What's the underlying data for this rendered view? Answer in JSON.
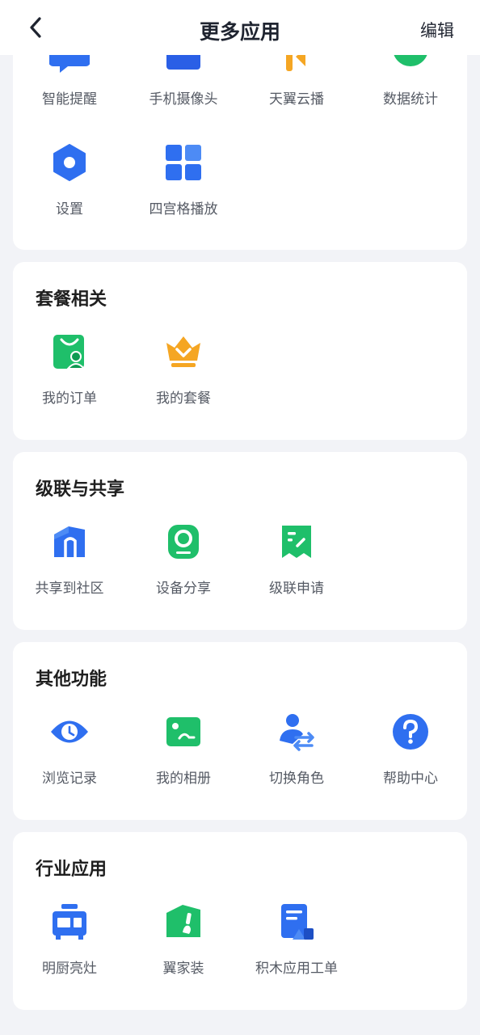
{
  "header": {
    "title": "更多应用",
    "edit_label": "编辑"
  },
  "sections": [
    {
      "title": "",
      "items": [
        {
          "label": "智能提醒",
          "icon": "reminder-icon"
        },
        {
          "label": "手机摄像头",
          "icon": "phone-camera-icon"
        },
        {
          "label": "天翼云播",
          "icon": "cloud-play-icon"
        },
        {
          "label": "数据统计",
          "icon": "statistics-icon"
        },
        {
          "label": "设置",
          "icon": "settings-icon"
        },
        {
          "label": "四宫格播放",
          "icon": "grid-play-icon"
        }
      ]
    },
    {
      "title": "套餐相关",
      "items": [
        {
          "label": "我的订单",
          "icon": "order-icon"
        },
        {
          "label": "我的套餐",
          "icon": "crown-icon"
        }
      ]
    },
    {
      "title": "级联与共享",
      "items": [
        {
          "label": "共享到社区",
          "icon": "community-icon"
        },
        {
          "label": "设备分享",
          "icon": "device-share-icon"
        },
        {
          "label": "级联申请",
          "icon": "cascade-apply-icon"
        }
      ]
    },
    {
      "title": "其他功能",
      "items": [
        {
          "label": "浏览记录",
          "icon": "history-icon"
        },
        {
          "label": "我的相册",
          "icon": "album-icon"
        },
        {
          "label": "切换角色",
          "icon": "switch-role-icon"
        },
        {
          "label": "帮助中心",
          "icon": "help-icon"
        }
      ]
    },
    {
      "title": "行业应用",
      "items": [
        {
          "label": "明厨亮灶",
          "icon": "kitchen-icon"
        },
        {
          "label": "翼家装",
          "icon": "decoration-icon"
        },
        {
          "label": "积木应用工单",
          "icon": "work-order-icon"
        }
      ]
    }
  ],
  "colors": {
    "blue": "#2f6ff0",
    "green": "#1fbf6a",
    "orange": "#f5a623",
    "background": "#f2f3f7"
  }
}
